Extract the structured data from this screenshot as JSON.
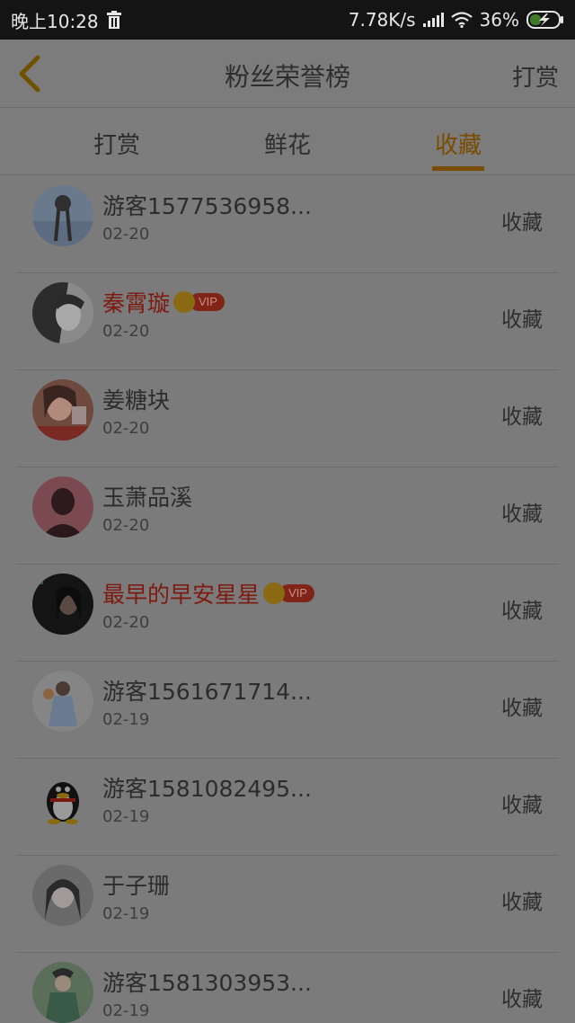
{
  "status_bar": {
    "time": "晚上10:28",
    "speed": "7.78K/s",
    "battery": "36%",
    "icons": [
      "trash-icon",
      "signal-icon",
      "wifi-icon",
      "battery-charging-icon"
    ]
  },
  "nav": {
    "title": "粉丝荣誉榜",
    "action_label": "打赏",
    "back_icon": "chevron-left-icon"
  },
  "tabs": [
    {
      "label": "打赏",
      "active": false
    },
    {
      "label": "鲜花",
      "active": false
    },
    {
      "label": "收藏",
      "active": true
    }
  ],
  "colors": {
    "accent": "#7a4c00",
    "vip_name": "#7e1a0f"
  },
  "list": [
    {
      "name": "游客1577536958...",
      "date": "02-20",
      "action": "收藏",
      "vip": false,
      "vip_label": ""
    },
    {
      "name": "秦霄璇",
      "date": "02-20",
      "action": "收藏",
      "vip": true,
      "vip_label": "VIP"
    },
    {
      "name": "姜糖块",
      "date": "02-20",
      "action": "收藏",
      "vip": false,
      "vip_label": ""
    },
    {
      "name": "玉萧品溪",
      "date": "02-20",
      "action": "收藏",
      "vip": false,
      "vip_label": ""
    },
    {
      "name": "最早的早安星星",
      "date": "02-20",
      "action": "收藏",
      "vip": true,
      "vip_label": "VIP"
    },
    {
      "name": "游客1561671714...",
      "date": "02-19",
      "action": "收藏",
      "vip": false,
      "vip_label": ""
    },
    {
      "name": "游客1581082495...",
      "date": "02-19",
      "action": "收藏",
      "vip": false,
      "vip_label": ""
    },
    {
      "name": "于子珊",
      "date": "02-19",
      "action": "收藏",
      "vip": false,
      "vip_label": ""
    },
    {
      "name": "游客1581303953...",
      "date": "02-19",
      "action": "收藏",
      "vip": false,
      "vip_label": ""
    }
  ]
}
